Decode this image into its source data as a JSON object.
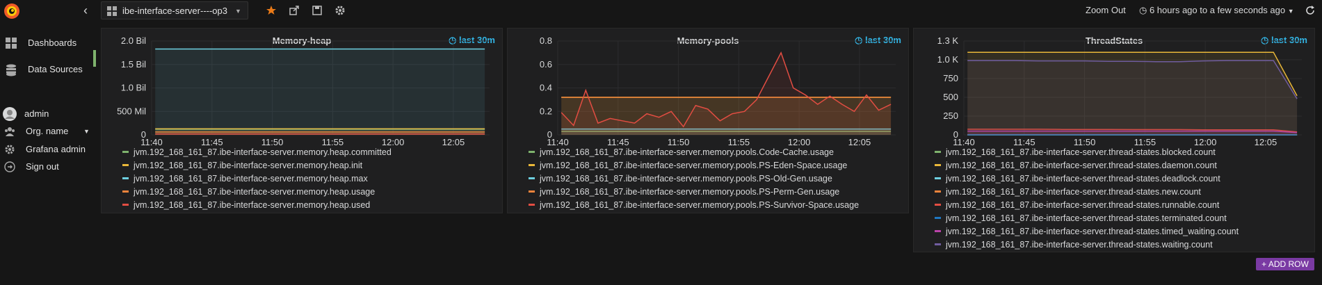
{
  "topbar": {
    "dashboard_title": "ibe-interface-server----op3",
    "zoom_out": "Zoom Out",
    "time_range": "6 hours ago to a few seconds ago"
  },
  "sidebar": {
    "items": [
      {
        "label": "Dashboards",
        "icon": "dashboards-icon"
      },
      {
        "label": "Data Sources",
        "icon": "database-icon"
      },
      {
        "label": "admin",
        "icon": "avatar"
      },
      {
        "label": "Org. name",
        "icon": "org-icon"
      },
      {
        "label": "Grafana admin",
        "icon": "gear-icon"
      },
      {
        "label": "Sign out",
        "icon": "sign-out-icon"
      }
    ]
  },
  "add_row_label": "+ ADD ROW",
  "colors": {
    "accent": "#33b5e5",
    "green": "#7eb26d",
    "yellow": "#eab839",
    "cyan": "#6ed0e0",
    "orange": "#ef843c",
    "red": "#e24d42",
    "blue": "#1f78c1",
    "pink": "#ba43a9",
    "purple": "#705da0"
  },
  "chart_data": [
    {
      "type": "line",
      "title": "Memory-heap",
      "time_badge": "last 30m",
      "x_ticks": [
        "11:40",
        "11:45",
        "11:50",
        "11:55",
        "12:00",
        "12:05"
      ],
      "y_ticks": [
        "0",
        "500 Mil",
        "1.0 Bil",
        "1.5 Bil",
        "2.0 Bil"
      ],
      "ylim": [
        0,
        2000000000
      ],
      "x_range": [
        "11:40",
        "12:08"
      ],
      "series": [
        {
          "name": "jvm.192_168_161_87.ibe-interface-server.memory.heap.committed",
          "color": "#7eb26d",
          "values": [
            120000000,
            120000000,
            120000000,
            120000000,
            120000000,
            120000000,
            120000000
          ]
        },
        {
          "name": "jvm.192_168_161_87.ibe-interface-server.memory.heap.init",
          "color": "#eab839",
          "values": [
            130000000,
            130000000,
            130000000,
            130000000,
            130000000,
            130000000,
            130000000
          ]
        },
        {
          "name": "jvm.192_168_161_87.ibe-interface-server.memory.heap.max",
          "color": "#6ed0e0",
          "values": [
            1830000000,
            1830000000,
            1830000000,
            1830000000,
            1830000000,
            1830000000,
            1830000000
          ]
        },
        {
          "name": "jvm.192_168_161_87.ibe-interface-server.memory.heap.usage",
          "color": "#ef843c",
          "values": [
            60000000,
            60000000,
            60000000,
            60000000,
            60000000,
            60000000,
            60000000
          ]
        },
        {
          "name": "jvm.192_168_161_87.ibe-interface-server.memory.heap.used",
          "color": "#e24d42",
          "values": [
            20000000,
            20000000,
            20000000,
            20000000,
            20000000,
            20000000,
            20000000
          ]
        }
      ]
    },
    {
      "type": "line",
      "title": "Memory-pools",
      "time_badge": "last 30m",
      "x_ticks": [
        "11:40",
        "11:45",
        "11:50",
        "11:55",
        "12:00",
        "12:05"
      ],
      "y_ticks": [
        "0",
        "0.2",
        "0.4",
        "0.6",
        "0.8"
      ],
      "ylim": [
        0,
        0.8
      ],
      "x_range": [
        "11:40",
        "12:08"
      ],
      "series": [
        {
          "name": "jvm.192_168_161_87.ibe-interface-server.memory.pools.Code-Cache.usage",
          "color": "#7eb26d",
          "values": [
            0.03,
            0.03,
            0.03,
            0.03,
            0.03,
            0.03,
            0.03
          ]
        },
        {
          "name": "jvm.192_168_161_87.ibe-interface-server.memory.pools.PS-Eden-Space.usage",
          "color": "#eab839",
          "values": [
            0.32,
            0.32,
            0.32,
            0.32,
            0.32,
            0.32,
            0.32
          ]
        },
        {
          "name": "jvm.192_168_161_87.ibe-interface-server.memory.pools.PS-Old-Gen.usage",
          "color": "#6ed0e0",
          "values": [
            0.05,
            0.05,
            0.05,
            0.05,
            0.05,
            0.05,
            0.05
          ]
        },
        {
          "name": "jvm.192_168_161_87.ibe-interface-server.memory.pools.PS-Perm-Gen.usage",
          "color": "#ef843c",
          "values": [
            0.32,
            0.32,
            0.32,
            0.32,
            0.32,
            0.32,
            0.32
          ]
        },
        {
          "name": "jvm.192_168_161_87.ibe-interface-server.memory.pools.PS-Survivor-Space.usage",
          "color": "#e24d42",
          "values": [
            0.19,
            0.08,
            0.38,
            0.1,
            0.14,
            0.12,
            0.1,
            0.18,
            0.15,
            0.2,
            0.07,
            0.25,
            0.22,
            0.12,
            0.18,
            0.2,
            0.3,
            0.5,
            0.7,
            0.4,
            0.34,
            0.26,
            0.33,
            0.26,
            0.2,
            0.34,
            0.21,
            0.26
          ]
        }
      ]
    },
    {
      "type": "line",
      "title": "ThreadStates",
      "time_badge": "last 30m",
      "x_ticks": [
        "11:40",
        "11:45",
        "11:50",
        "11:55",
        "12:00",
        "12:05"
      ],
      "y_ticks": [
        "0",
        "250",
        "500",
        "750",
        "1.0 K",
        "1.3 K"
      ],
      "ylim": [
        0,
        1250
      ],
      "x_range": [
        "11:40",
        "12:08"
      ],
      "series": [
        {
          "name": "jvm.192_168_161_87.ibe-interface-server.thread-states.blocked.count",
          "color": "#7eb26d",
          "values": [
            0,
            0,
            0,
            0,
            0,
            0,
            0,
            0,
            0,
            0,
            0,
            0,
            0,
            0,
            0
          ]
        },
        {
          "name": "jvm.192_168_161_87.ibe-interface-server.thread-states.daemon.count",
          "color": "#eab839",
          "values": [
            1100,
            1100,
            1100,
            1100,
            1100,
            1100,
            1100,
            1100,
            1100,
            1100,
            1100,
            1100,
            1100,
            1100,
            520
          ]
        },
        {
          "name": "jvm.192_168_161_87.ibe-interface-server.thread-states.deadlock.count",
          "color": "#6ed0e0",
          "values": [
            0,
            0,
            0,
            0,
            0,
            0,
            0,
            0,
            0,
            0,
            0,
            0,
            0,
            0,
            0
          ]
        },
        {
          "name": "jvm.192_168_161_87.ibe-interface-server.thread-states.new.count",
          "color": "#ef843c",
          "values": [
            0,
            0,
            0,
            0,
            0,
            0,
            0,
            0,
            0,
            0,
            0,
            0,
            0,
            0,
            0
          ]
        },
        {
          "name": "jvm.192_168_161_87.ibe-interface-server.thread-states.runnable.count",
          "color": "#e24d42",
          "values": [
            75,
            75,
            75,
            75,
            72,
            72,
            72,
            70,
            70,
            70,
            68,
            68,
            68,
            68,
            40
          ]
        },
        {
          "name": "jvm.192_168_161_87.ibe-interface-server.thread-states.terminated.count",
          "color": "#1f78c1",
          "values": [
            0,
            0,
            0,
            0,
            0,
            0,
            0,
            0,
            0,
            0,
            0,
            0,
            0,
            0,
            0
          ]
        },
        {
          "name": "jvm.192_168_161_87.ibe-interface-server.thread-states.timed_waiting.count",
          "color": "#ba43a9",
          "values": [
            50,
            50,
            50,
            50,
            50,
            50,
            50,
            50,
            50,
            50,
            50,
            50,
            50,
            50,
            30
          ]
        },
        {
          "name": "jvm.192_168_161_87.ibe-interface-server.thread-states.waiting.count",
          "color": "#705da0",
          "values": [
            990,
            990,
            990,
            985,
            985,
            985,
            980,
            980,
            975,
            975,
            985,
            990,
            990,
            990,
            480
          ]
        }
      ]
    }
  ]
}
